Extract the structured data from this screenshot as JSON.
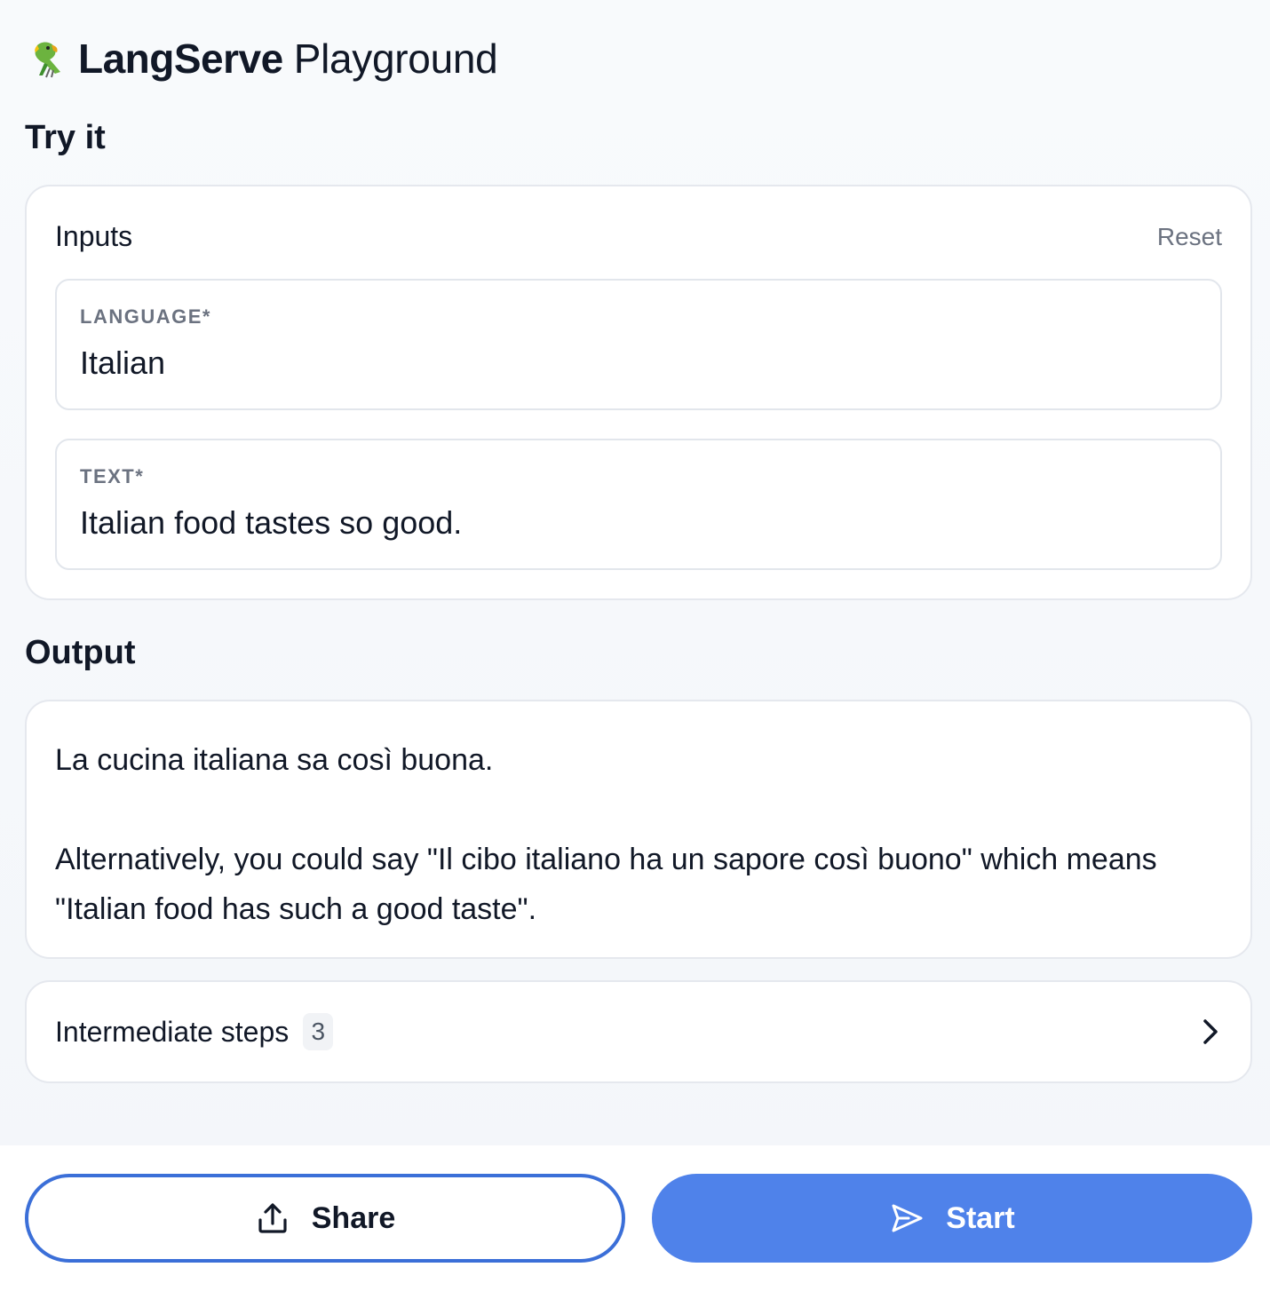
{
  "header": {
    "logo_emoji": "🦜",
    "brand": "LangServe",
    "subtitle": "Playground"
  },
  "try_it": {
    "heading": "Try it",
    "inputs_label": "Inputs",
    "reset_label": "Reset",
    "fields": [
      {
        "label": "LANGUAGE*",
        "value": "Italian"
      },
      {
        "label": "TEXT*",
        "value": "Italian food tastes so good."
      }
    ]
  },
  "output": {
    "heading": "Output",
    "paragraph_1": "La cucina italiana sa così buona.",
    "paragraph_2": "Alternatively, you could say \"Il cibo italiano ha un sapore così buono\" which means \"Italian food has such a good taste\"."
  },
  "intermediate_steps": {
    "label": "Intermediate steps",
    "count": "3",
    "icon": "chevron-right-icon"
  },
  "actions": {
    "share_label": "Share",
    "share_icon": "share-upload-icon",
    "start_label": "Start",
    "start_icon": "send-icon"
  },
  "colors": {
    "accent": "#4f82ea",
    "share_border": "#3b6fd8",
    "muted_text": "#6b7280",
    "background": "#f6f8fb"
  }
}
